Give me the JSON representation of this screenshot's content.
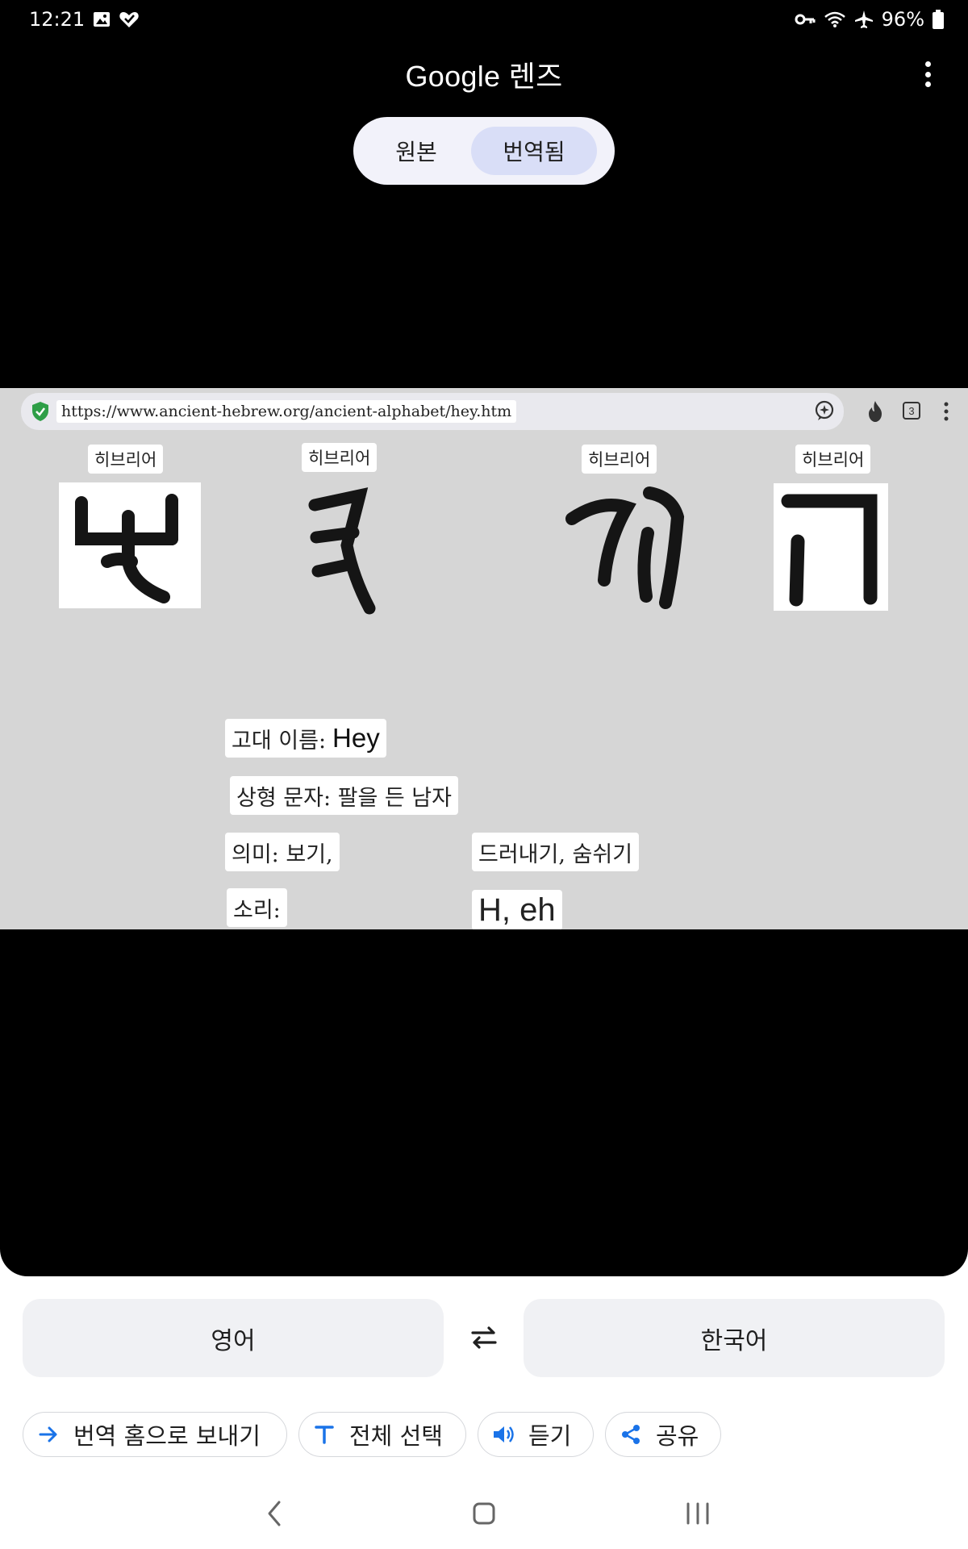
{
  "status_bar": {
    "time": "12:21",
    "battery": "96%"
  },
  "header": {
    "title": "Google 렌즈",
    "toggle": {
      "original_label": "원본",
      "translated_label": "번역됨"
    }
  },
  "image": {
    "url": "https://www.ancient-hebrew.org/ancient-alphabet/hey.htm",
    "tab_count": "3",
    "script_labels": [
      "히브리어",
      "히브리어",
      "히브리어",
      "히브리어"
    ],
    "ancient_name_label": "고대 이름:",
    "ancient_name_value": "Hey",
    "pictograph": "상형 문자: 팔을 든 남자",
    "meaning_label": "의미: 보기,",
    "meaning_value": "드러내기, 숨쉬기",
    "sound_label": "소리:",
    "sound_value": "H, eh"
  },
  "languages": {
    "source": "영어",
    "target": "한국어"
  },
  "actions": {
    "send_home": "번역 홈으로 보내기",
    "select_all": "전체 선택",
    "listen": "듣기",
    "share": "공유"
  },
  "colors": {
    "accent": "#1a73e8",
    "toggle_selected": "#d9def7",
    "viewer_bg": "#000000"
  }
}
